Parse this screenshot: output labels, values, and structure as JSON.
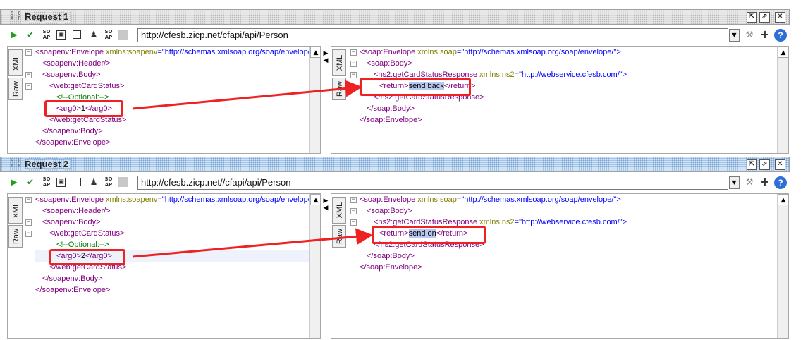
{
  "requests": [
    {
      "title": "Request 1",
      "url": "http://cfesb.zicp.net/cfapi/api/Person",
      "left_tabs": [
        "XML",
        "Raw"
      ],
      "request_xml": {
        "envelope_open_tag": "<soapenv:Envelope",
        "envelope_attr": "xmlns:soapenv",
        "envelope_val": "=\"http://schemas.xmlsoap.org/soap/envelope/",
        "header": "<soapenv:Header/>",
        "body_open": "<soapenv:Body>",
        "op_open": "<web:getCardStatus>",
        "comment": "<!--Optional:-->",
        "arg_open": "<arg0>",
        "arg_value": "1",
        "arg_close": "</arg0>",
        "op_close": "</web:getCardStatus>",
        "body_close": "</soapenv:Body>",
        "envelope_close": "</soapenv:Envelope>"
      },
      "response_xml": {
        "envelope_open_tag": "<soap:Envelope",
        "envelope_attr": "xmlns:soap",
        "envelope_val": "=\"http://schemas.xmlsoap.org/soap/envelope/\">",
        "body_open": "<soap:Body>",
        "resp_open_tag": "<ns2:getCardStatusResponse",
        "resp_attr": "xmlns:ns2",
        "resp_val": "=\"http://webservice.cfesb.com/\">",
        "return_open": "<return>",
        "return_value": "send back",
        "return_close": "</return>",
        "resp_close": "</ns2:getCardStatusResponse>",
        "body_close": "</soap:Body>",
        "envelope_close": "</soap:Envelope>"
      }
    },
    {
      "title": "Request 2",
      "url": "http://cfesb.zicp.net//cfapi/api/Person",
      "left_tabs": [
        "XML",
        "Raw"
      ],
      "request_xml": {
        "envelope_open_tag": "<soapenv:Envelope",
        "envelope_attr": "xmlns:soapenv",
        "envelope_val": "=\"http://schemas.xmlsoap.org/soap/envelope/",
        "header": "<soapenv:Header/>",
        "body_open": "<soapenv:Body>",
        "op_open": "<web:getCardStatus>",
        "comment": "<!--Optional:-->",
        "arg_open": "<arg0>",
        "arg_value": "2",
        "arg_close": "</arg0>",
        "op_close": "</web:getCardStatus>",
        "body_close": "</soapenv:Body>",
        "envelope_close": "</soapenv:Envelope>"
      },
      "response_xml": {
        "envelope_open_tag": "<soap:Envelope",
        "envelope_attr": "xmlns:soap",
        "envelope_val": "=\"http://schemas.xmlsoap.org/soap/envelope/\">",
        "body_open": "<soap:Body>",
        "resp_open_tag": "<ns2:getCardStatusResponse",
        "resp_attr": "xmlns:ns2",
        "resp_val": "=\"http://webservice.cfesb.com/\">",
        "return_open": "<return>",
        "return_value": "send on",
        "return_close": "</return>",
        "resp_close": "</ns2:getCardStatusResponse>",
        "body_close": "</soap:Body>",
        "envelope_close": "</soap:Envelope>"
      }
    }
  ],
  "icons": {
    "run": "run-icon",
    "add-assertion": "checkmark-icon",
    "soap": "soap-icon",
    "frame": "frame-icon",
    "stop": "stop-icon",
    "person": "person-icon",
    "gear": "gear-icon",
    "maximize": "maximize-icon",
    "close": "close-icon",
    "settings": "wrench-icon",
    "plus": "plus-icon",
    "help": "help-icon"
  },
  "colors": {
    "annotation": "#ee2222",
    "tag": "#800080",
    "attr": "#808000",
    "value": "#0000ff",
    "comment": "#008000",
    "selection": "#b8c8f0"
  }
}
